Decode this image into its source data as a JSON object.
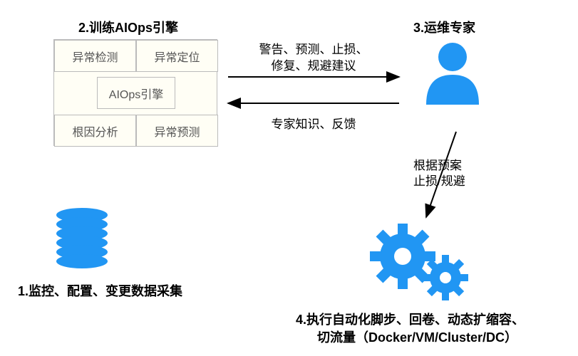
{
  "nodes": {
    "n1": {
      "title": "1.监控、配置、变更数据采集"
    },
    "n2": {
      "title": "2.训练AIOps引擎",
      "cells": {
        "tl": "异常检测",
        "tr": "异常定位",
        "mid": "AIOps引擎",
        "bl": "根因分析",
        "br": "异常预测"
      }
    },
    "n3": {
      "title": "3.运维专家"
    },
    "n4": {
      "title_line1": "4.执行自动化脚步、回卷、动态扩缩容、",
      "title_line2": "切流量（Docker/VM/Cluster/DC）"
    }
  },
  "edges": {
    "e_2to3_line1": "警告、预测、止损、",
    "e_2to3_line2": "修复、规避建议",
    "e_3to2": "专家知识、反馈",
    "e_3to4_line1": "根据预案",
    "e_3to4_line2": "止损/规避"
  },
  "colors": {
    "accent": "#2196F3"
  }
}
